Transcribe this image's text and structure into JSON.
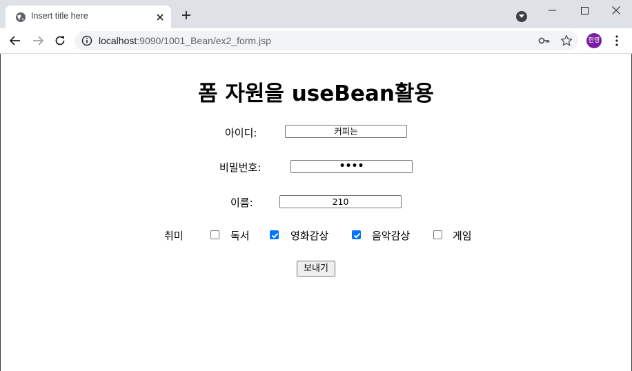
{
  "browser": {
    "tab_title": "Insert title here",
    "url_host": "localhost",
    "url_path": ":9090/1001_Bean/ex2_form.jsp",
    "profile_label": "한영"
  },
  "page": {
    "title": "폼 자원을 useBean활용",
    "id_label": "아이디:",
    "id_value": "커피는",
    "password_label": "비밀번호:",
    "password_value": "••••",
    "name_label": "이름:",
    "name_value": "210",
    "hobby_label": "취미",
    "hobbies": [
      {
        "label": "독서",
        "checked": false
      },
      {
        "label": "영화감상",
        "checked": true
      },
      {
        "label": "음악감상",
        "checked": true
      },
      {
        "label": "게임",
        "checked": false
      }
    ],
    "submit_label": "보내기"
  },
  "colors": {
    "accent": "#0075ff",
    "chrome": "#dee1e6",
    "avatar": "#7b1fa2"
  }
}
